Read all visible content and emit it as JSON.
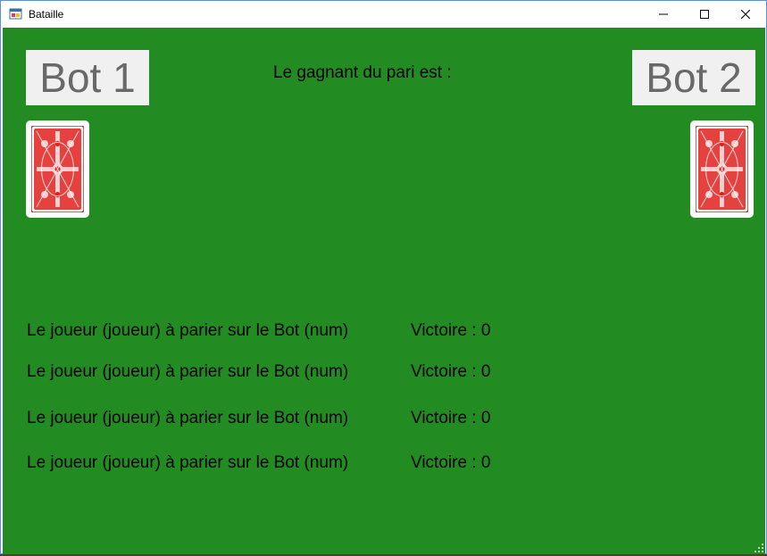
{
  "window": {
    "title": "Bataille",
    "icon": "winforms-app-icon",
    "controls": [
      "minimize-icon",
      "maximize-icon",
      "close-icon"
    ]
  },
  "game": {
    "bot1_label": "Bot 1",
    "bot2_label": "Bot 2",
    "winner_label": "Le gagnant du pari est :",
    "card_back_color": "#e0201c",
    "bets": [
      {
        "text": "Le joueur (joueur) à parier sur le Bot (num)",
        "victory": "Victoire : 0"
      },
      {
        "text": "Le joueur (joueur) à parier sur le Bot (num)",
        "victory": "Victoire : 0"
      },
      {
        "text": "Le joueur (joueur) à parier sur le Bot (num)",
        "victory": "Victoire : 0"
      },
      {
        "text": "Le joueur (joueur) à parier sur le Bot (num)",
        "victory": "Victoire : 0"
      }
    ]
  },
  "colors": {
    "table_green": "#228b22",
    "label_bg": "#f0f0f0",
    "label_text": "#696969"
  }
}
